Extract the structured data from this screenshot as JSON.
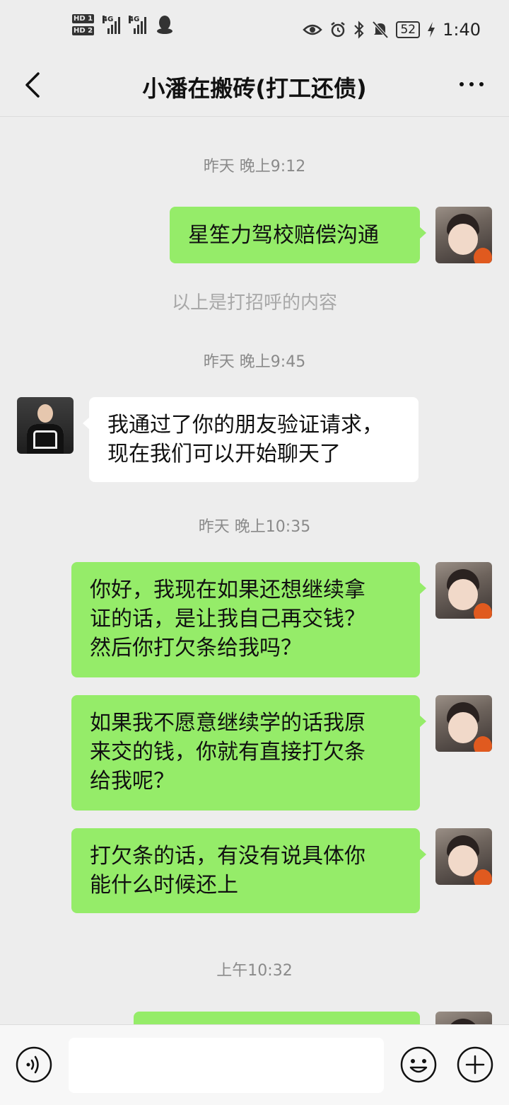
{
  "status_bar": {
    "hd1": "HD 1",
    "hd2": "HD 2",
    "net1": "4G",
    "net2": "4G",
    "battery": "52",
    "time": "1:40",
    "icons": [
      "eye-icon",
      "alarm-icon",
      "bluetooth-icon",
      "mute-icon",
      "charging-icon",
      "qq-icon"
    ]
  },
  "header": {
    "title": "小潘在搬砖(打工还债)"
  },
  "chat": {
    "timestamps": [
      "昨天 晚上9:12",
      "昨天 晚上9:45",
      "昨天 晚上10:35",
      "上午10:32"
    ],
    "system_notice": "以上是打招呼的内容",
    "messages": [
      {
        "sender": "me",
        "text": "星笙力驾校赔偿沟通"
      },
      {
        "sender": "them",
        "text": "我通过了你的朋友验证请求，\n现在我们可以开始聊天了"
      },
      {
        "sender": "me",
        "text": "你好，我现在如果还想继续拿\n证的话，是让我自己再交钱？\n然后你打欠条给我吗？"
      },
      {
        "sender": "me",
        "text": "如果我不愿意继续学的话我原\n来交的钱，你就有直接打欠条\n给我呢？"
      },
      {
        "sender": "me",
        "text": "打欠条的话，有没有说具体你\n能什么时候还上"
      },
      {
        "sender": "me",
        "text": ""
      }
    ]
  },
  "input_bar": {
    "placeholder": "",
    "icons": [
      "voice-icon",
      "emoji-icon",
      "plus-icon"
    ]
  },
  "colors": {
    "background": "#ededed",
    "my_bubble": "#95ec69",
    "their_bubble": "#ffffff",
    "timestamp": "#8a8a8a"
  }
}
